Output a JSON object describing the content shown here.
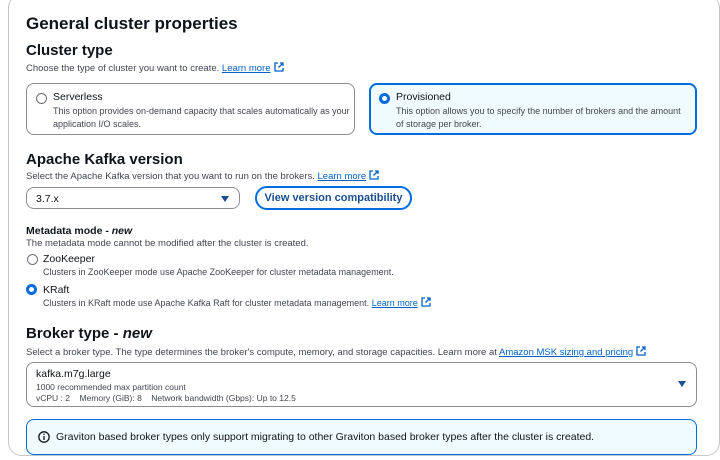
{
  "section_title": "General cluster properties",
  "cluster_type": {
    "heading": "Cluster type",
    "description": "Choose the type of cluster you want to create.",
    "learn_more": "Learn more",
    "options": [
      {
        "label": "Serverless",
        "desc_line1": "This option provides on-demand capacity that scales automatically as your",
        "desc_line2": "application I/O scales.",
        "selected": false
      },
      {
        "label": "Provisioned",
        "desc_line1": "This option allows you to specify the number of brokers and the amount",
        "desc_line2": "of storage per broker.",
        "selected": true
      }
    ]
  },
  "kafka_version": {
    "heading": "Apache Kafka version",
    "description": "Select the Apache Kafka version that you want to run on the brokers.",
    "learn_more": "Learn more",
    "selected_value": "3.7.x",
    "compat_button": "View version compatibility"
  },
  "metadata_mode": {
    "heading": "Metadata mode - ",
    "heading_new": "new",
    "description": "The metadata mode cannot be modified after the cluster is created.",
    "options": [
      {
        "label": "ZooKeeper",
        "desc": "Clusters in ZooKeeper mode use Apache ZooKeeper for cluster metadata management.",
        "selected": false
      },
      {
        "label": "KRaft",
        "desc": "Clusters in KRaft mode use Apache Kafka Raft for cluster metadata management.",
        "learn_more": "Learn more",
        "selected": true
      }
    ]
  },
  "broker_type": {
    "heading": "Broker type - ",
    "heading_new": "new",
    "description": "Select a broker type. The type determines the broker's compute, memory, and storage capacities. Learn more at",
    "link": "Amazon MSK sizing and pricing",
    "selected_value": "kafka.m7g.large",
    "partition_count": "1000 recommended max partition count",
    "specs": "vCPU : 2    Memory (GiB): 8    Network bandwidth (Gbps): Up to 12.5"
  },
  "info_alert": "Graviton based broker types only support migrating to other Graviton based broker types after the cluster is created.",
  "colors": {
    "accent": "#006ce0",
    "link": "#0062c9",
    "selected_bg": "#f0fbff"
  }
}
